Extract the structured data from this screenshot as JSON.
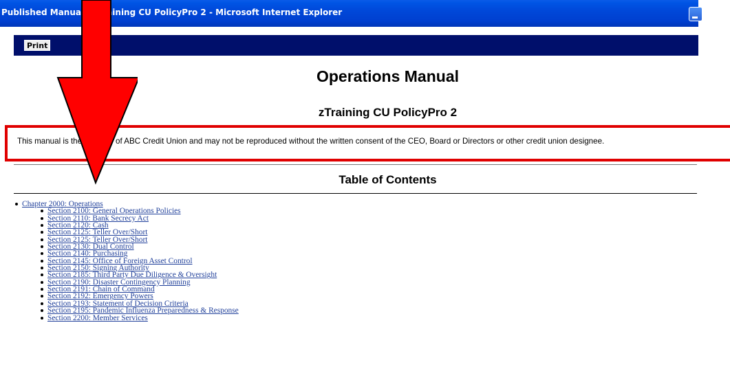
{
  "window": {
    "title": "Published Manual - zTraining CU PolicyPro 2 - Microsoft Internet Explorer"
  },
  "toolbar": {
    "print_label": "Print"
  },
  "document": {
    "heading": "Operations Manual",
    "subheading": "zTraining CU PolicyPro 2",
    "notice": "This manual is the property of ABC Credit Union and may not be reproduced without the written consent of the CEO, Board or Directors or other credit union designee.",
    "toc_title": "Table of Contents"
  },
  "toc": {
    "chapter": "Chapter 2000: Operations",
    "sections": [
      "Section 2100: General Operations Policies",
      "Section 2110: Bank Secrecy Act",
      "Section 2120: Cash",
      "Section 2125: Teller Over/Short",
      "Section 2125: Teller Over/Short",
      "Section 2130: Dual Control",
      "Section 2140: Purchasing",
      "Section 2145: Office of Foreign Asset Control",
      "Section 2150: Signing Authority",
      "Section 2185: Third Party Due Diligence & Oversight",
      "Section 2190: Disaster Contingency Planning",
      "Section 2191: Chain of Command",
      "Section 2192: Emergency Powers",
      "Section 2193: Statement of Decision Criteria",
      "Section 2195: Pandemic Influenza Preparedness & Response",
      "Section 2200: Member Services"
    ]
  },
  "annotation": {
    "arrow_color": "#ff0000",
    "highlight_color": "#e00000"
  }
}
